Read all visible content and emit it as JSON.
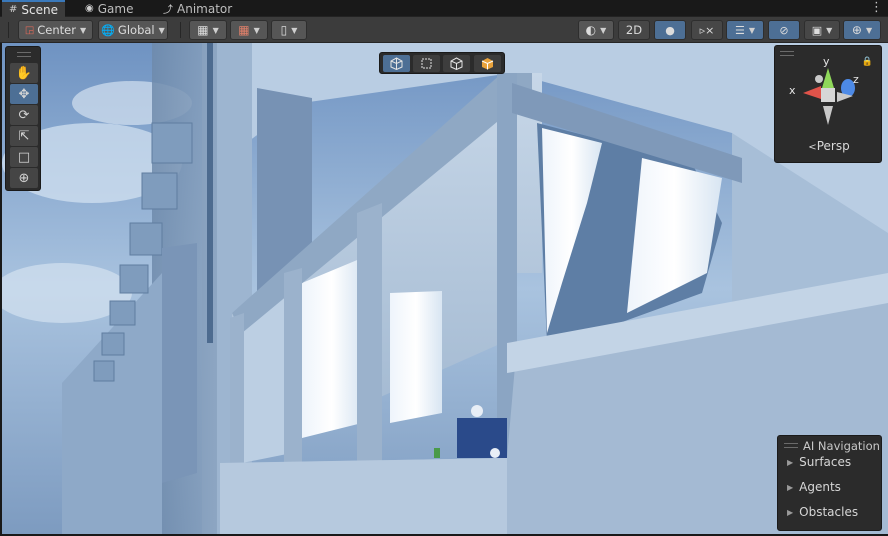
{
  "tabs": [
    {
      "label": "Scene",
      "icon": "grid-icon",
      "active": true
    },
    {
      "label": "Game",
      "icon": "gamepad-icon",
      "active": false
    },
    {
      "label": "Animator",
      "icon": "animator-icon",
      "active": false
    }
  ],
  "toolbar": {
    "pivot_label": "Center",
    "space_label": "Global",
    "mode_2d_label": "2D"
  },
  "tools_palette": [
    "hand-tool",
    "move-tool",
    "rotate-tool",
    "scale-tool",
    "rect-tool",
    "transform-tool"
  ],
  "active_tool": "move-tool",
  "overlay_toolbar": [
    "wireframe-cube",
    "rect-select",
    "shaded-cube",
    "textured-cube"
  ],
  "gizmo": {
    "x_label": "x",
    "y_label": "y",
    "z_label": "z",
    "projection_label": "Persp"
  },
  "ai_navigation": {
    "title": "AI Navigation",
    "items": [
      "Surfaces",
      "Agents",
      "Obstacles"
    ]
  },
  "colors": {
    "accent": "#3a79bb",
    "active_button": "#4d6f95",
    "panel": "#2b2b2b",
    "x_axis": "#e0534a",
    "y_axis": "#8fd85a",
    "z_axis": "#4d8ae6"
  }
}
